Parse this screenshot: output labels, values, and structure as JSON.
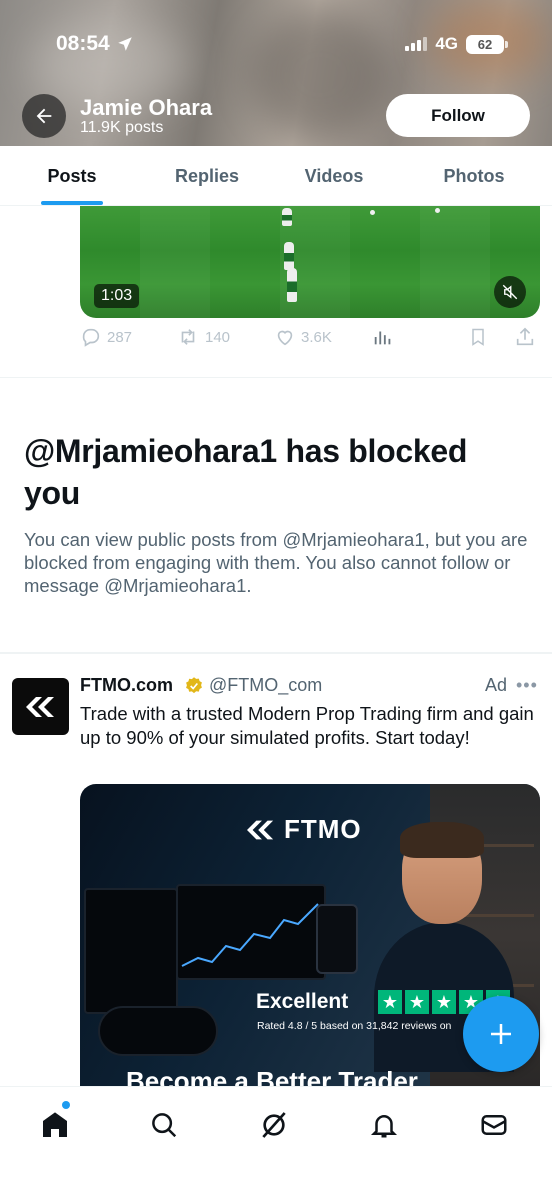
{
  "status_bar": {
    "time": "08:54",
    "network": "4G",
    "battery": "62"
  },
  "profile": {
    "name": "Jamie Ohara",
    "posts_count": "11.9K posts",
    "follow_label": "Follow"
  },
  "tabs": [
    {
      "label": "Posts",
      "active": true
    },
    {
      "label": "Replies",
      "active": false
    },
    {
      "label": "Videos",
      "active": false
    },
    {
      "label": "Photos",
      "active": false
    }
  ],
  "video_post": {
    "duration": "1:03",
    "replies": "287",
    "reposts": "140",
    "likes": "3.6K"
  },
  "blocked_notice": {
    "title": "@Mrjamieohara1 has blocked you",
    "message": "You can view public posts from @Mrjamieohara1, but you are blocked from engaging with them. You also cannot follow or message @Mrjamieohara1."
  },
  "ad_post": {
    "name": "FTMO.com",
    "handle": "@FTMO_com",
    "label": "Ad",
    "text": "Trade with a trusted Modern Prop Trading firm and gain up to 90% of your simulated profits. Start today!",
    "image": {
      "brand": "FTMO",
      "rating_word": "Excellent",
      "rating_detail": "Rated 4.8 / 5 based on 31,842 reviews on",
      "headline": "Become a Better Trader"
    }
  },
  "colors": {
    "accent": "#1d9bf0",
    "text": "#0f1419",
    "muted": "#536471",
    "trustpilot": "#00b67a"
  },
  "bottom_nav": [
    "home-icon",
    "search-icon",
    "grok-icon",
    "notifications-icon",
    "messages-icon"
  ]
}
